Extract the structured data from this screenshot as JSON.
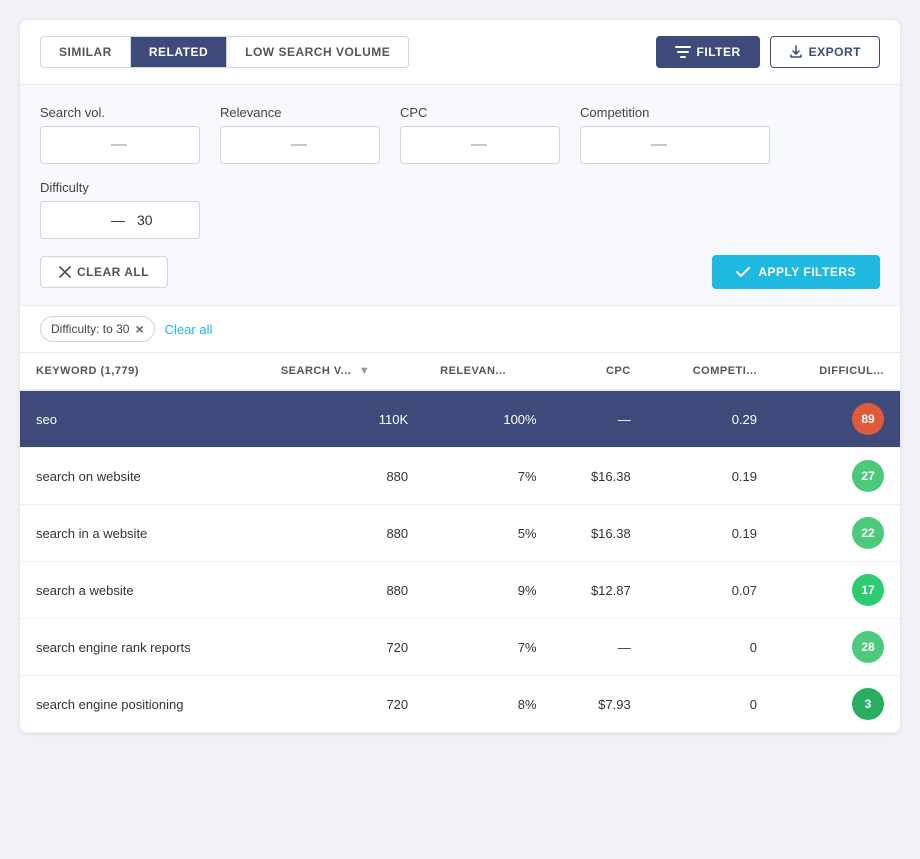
{
  "tabs": [
    {
      "id": "similar",
      "label": "SIMILAR",
      "active": false
    },
    {
      "id": "related",
      "label": "RELATED",
      "active": true
    },
    {
      "id": "low-search-volume",
      "label": "LOW SEARCH VOLUME",
      "active": false
    }
  ],
  "actions": {
    "filter_label": "FILTER",
    "export_label": "EXPORT"
  },
  "filters": {
    "search_vol_label": "Search vol.",
    "relevance_label": "Relevance",
    "cpc_label": "CPC",
    "competition_label": "Competition",
    "difficulty_label": "Difficulty",
    "difficulty_value": "30",
    "clear_all_label": "CLEAR ALL",
    "apply_label": "APPLY FILTERS"
  },
  "active_filter": {
    "tag": "Difficulty: to 30",
    "clear_label": "Clear all"
  },
  "table": {
    "columns": [
      {
        "id": "keyword",
        "label": "KEYWORD (1,779)"
      },
      {
        "id": "search_vol",
        "label": "SEARCH V..."
      },
      {
        "id": "relevance",
        "label": "RELEVAN..."
      },
      {
        "id": "cpc",
        "label": "CPC"
      },
      {
        "id": "competition",
        "label": "COMPETI..."
      },
      {
        "id": "difficulty",
        "label": "DIFFICUL..."
      }
    ],
    "rows": [
      {
        "keyword": "seo",
        "search_vol": "110K",
        "relevance": "100%",
        "cpc": "—",
        "competition": "0.29",
        "difficulty": "89",
        "diff_class": "diff-red",
        "highlight": true
      },
      {
        "keyword": "search on website",
        "search_vol": "880",
        "relevance": "7%",
        "cpc": "$16.38",
        "competition": "0.19",
        "difficulty": "27",
        "diff_class": "diff-green-light",
        "highlight": false
      },
      {
        "keyword": "search in a website",
        "search_vol": "880",
        "relevance": "5%",
        "cpc": "$16.38",
        "competition": "0.19",
        "difficulty": "22",
        "diff_class": "diff-green-light",
        "highlight": false
      },
      {
        "keyword": "search a website",
        "search_vol": "880",
        "relevance": "9%",
        "cpc": "$12.87",
        "competition": "0.07",
        "difficulty": "17",
        "diff_class": "diff-green",
        "highlight": false
      },
      {
        "keyword": "search engine rank reports",
        "search_vol": "720",
        "relevance": "7%",
        "cpc": "—",
        "competition": "0",
        "difficulty": "28",
        "diff_class": "diff-green-light",
        "highlight": false
      },
      {
        "keyword": "search engine positioning",
        "search_vol": "720",
        "relevance": "8%",
        "cpc": "$7.93",
        "competition": "0",
        "difficulty": "3",
        "diff_class": "diff-green-dark",
        "highlight": false
      }
    ]
  }
}
